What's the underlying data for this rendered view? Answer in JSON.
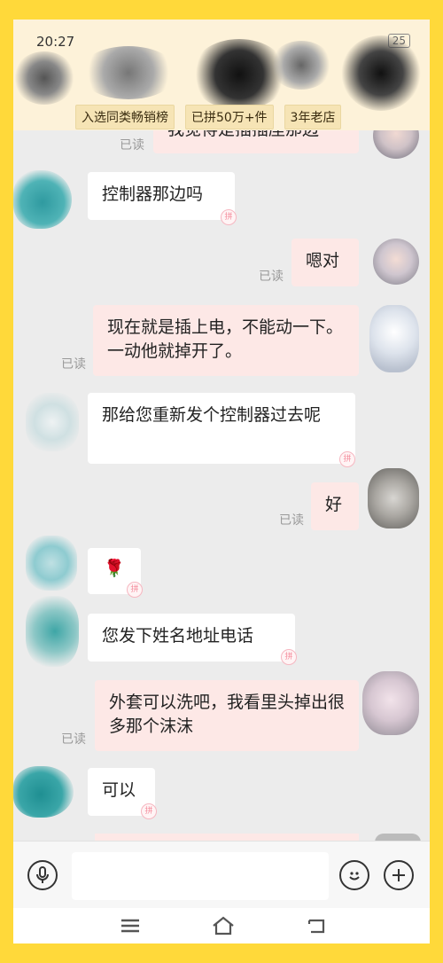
{
  "status_bar": {
    "time": "20:27",
    "battery": "25"
  },
  "header": {
    "tags": [
      "入选同类畅销榜",
      "已拼50万+件",
      "3年老店"
    ]
  },
  "messages": [
    {
      "side": "right",
      "text": "我觉得是插插座那边",
      "read": "已读"
    },
    {
      "side": "left",
      "text": "控制器那边吗"
    },
    {
      "side": "right",
      "text": "嗯对",
      "read": "已读"
    },
    {
      "side": "right",
      "text": "现在就是插上电，不能动一下。一动他就掉开了。",
      "read": "已读"
    },
    {
      "side": "left",
      "text": "那给您重新发个控制器过去呢"
    },
    {
      "side": "right",
      "text": "好",
      "read": "已读"
    },
    {
      "side": "left",
      "text": "🌹"
    },
    {
      "side": "left",
      "text": "您发下姓名地址电话"
    },
    {
      "side": "right",
      "text": "外套可以洗吧，我看里头掉出很多那个沫沫",
      "read": "已读"
    },
    {
      "side": "left",
      "text": "可以"
    }
  ],
  "input": {
    "placeholder": ""
  },
  "icons": {
    "voice": "microphone-icon",
    "emoji": "emoji-icon",
    "more": "plus-icon",
    "nav_menu": "menu-icon",
    "nav_home": "home-icon",
    "nav_back": "back-icon"
  },
  "colors": {
    "frame": "#FFD93A",
    "own_bubble": "#fde8e6",
    "other_bubble": "#ffffff"
  }
}
